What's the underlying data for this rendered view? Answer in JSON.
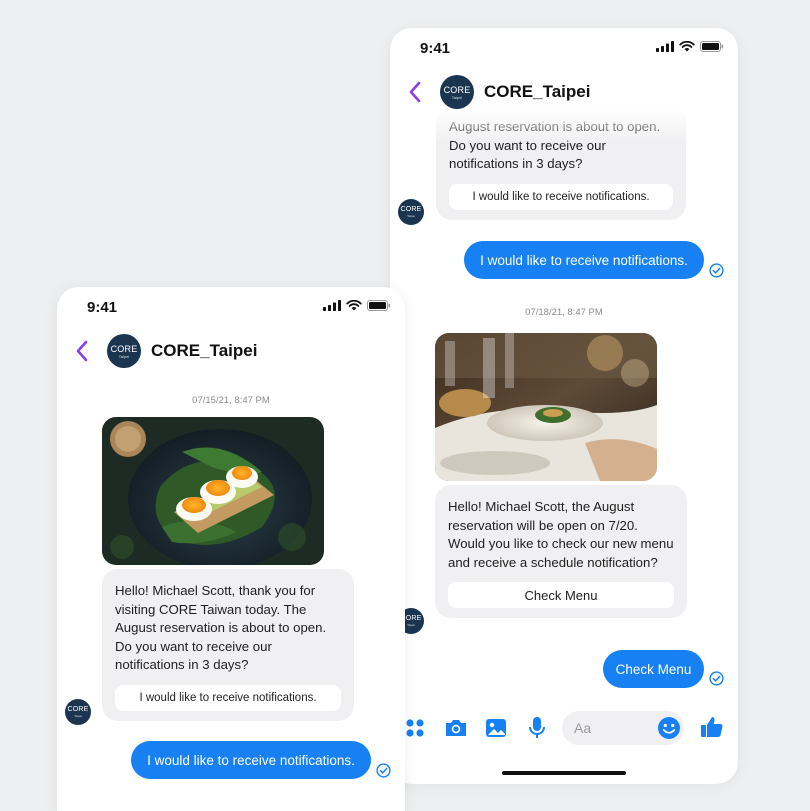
{
  "back_phone": {
    "status_time": "9:41",
    "contact_name": "CORE_Taipei",
    "avatar_text": "CORE",
    "avatar_sub": "Taipei",
    "msg_partial": "August reservation is about to open. Do you want to receive our notifications in 3 days?",
    "msg_partial_button": "I would like to receive notifications.",
    "reply_1": "I would like to receive notifications.",
    "timestamp": "07/18/21, 8:47 PM",
    "msg_2": "Hello! Michael Scott, the August reservation will be open on 7/20. Would you like to check our new menu and receive a schedule notification?",
    "msg_2_button": "Check Menu",
    "reply_2": "Check Menu",
    "input_placeholder": "Aa"
  },
  "front_phone": {
    "status_time": "9:41",
    "contact_name": "CORE_Taipei",
    "avatar_text": "CORE",
    "avatar_sub": "Taipei",
    "timestamp": "07/15/21, 8:47 PM",
    "msg_1": "Hello! Michael Scott, thank you for visiting CORE Taiwan today. The August reservation is about to open. Do you want to receive our notifications in 3 days?",
    "msg_1_button": "I would like to receive notifications.",
    "reply_1": "I would like to receive notifications."
  },
  "colors": {
    "accent_blue": "#1781f3",
    "back_arrow_purple": "#8a3ff0",
    "incoming_bubble": "#f0f0f2",
    "avatar_bg": "#1b3550"
  },
  "icons": [
    "back-arrow-icon",
    "signal-icon",
    "wifi-icon",
    "battery-icon",
    "read-check-icon",
    "apps-icon",
    "camera-icon",
    "gallery-icon",
    "microphone-icon",
    "emoji-icon",
    "thumbs-up-icon"
  ]
}
